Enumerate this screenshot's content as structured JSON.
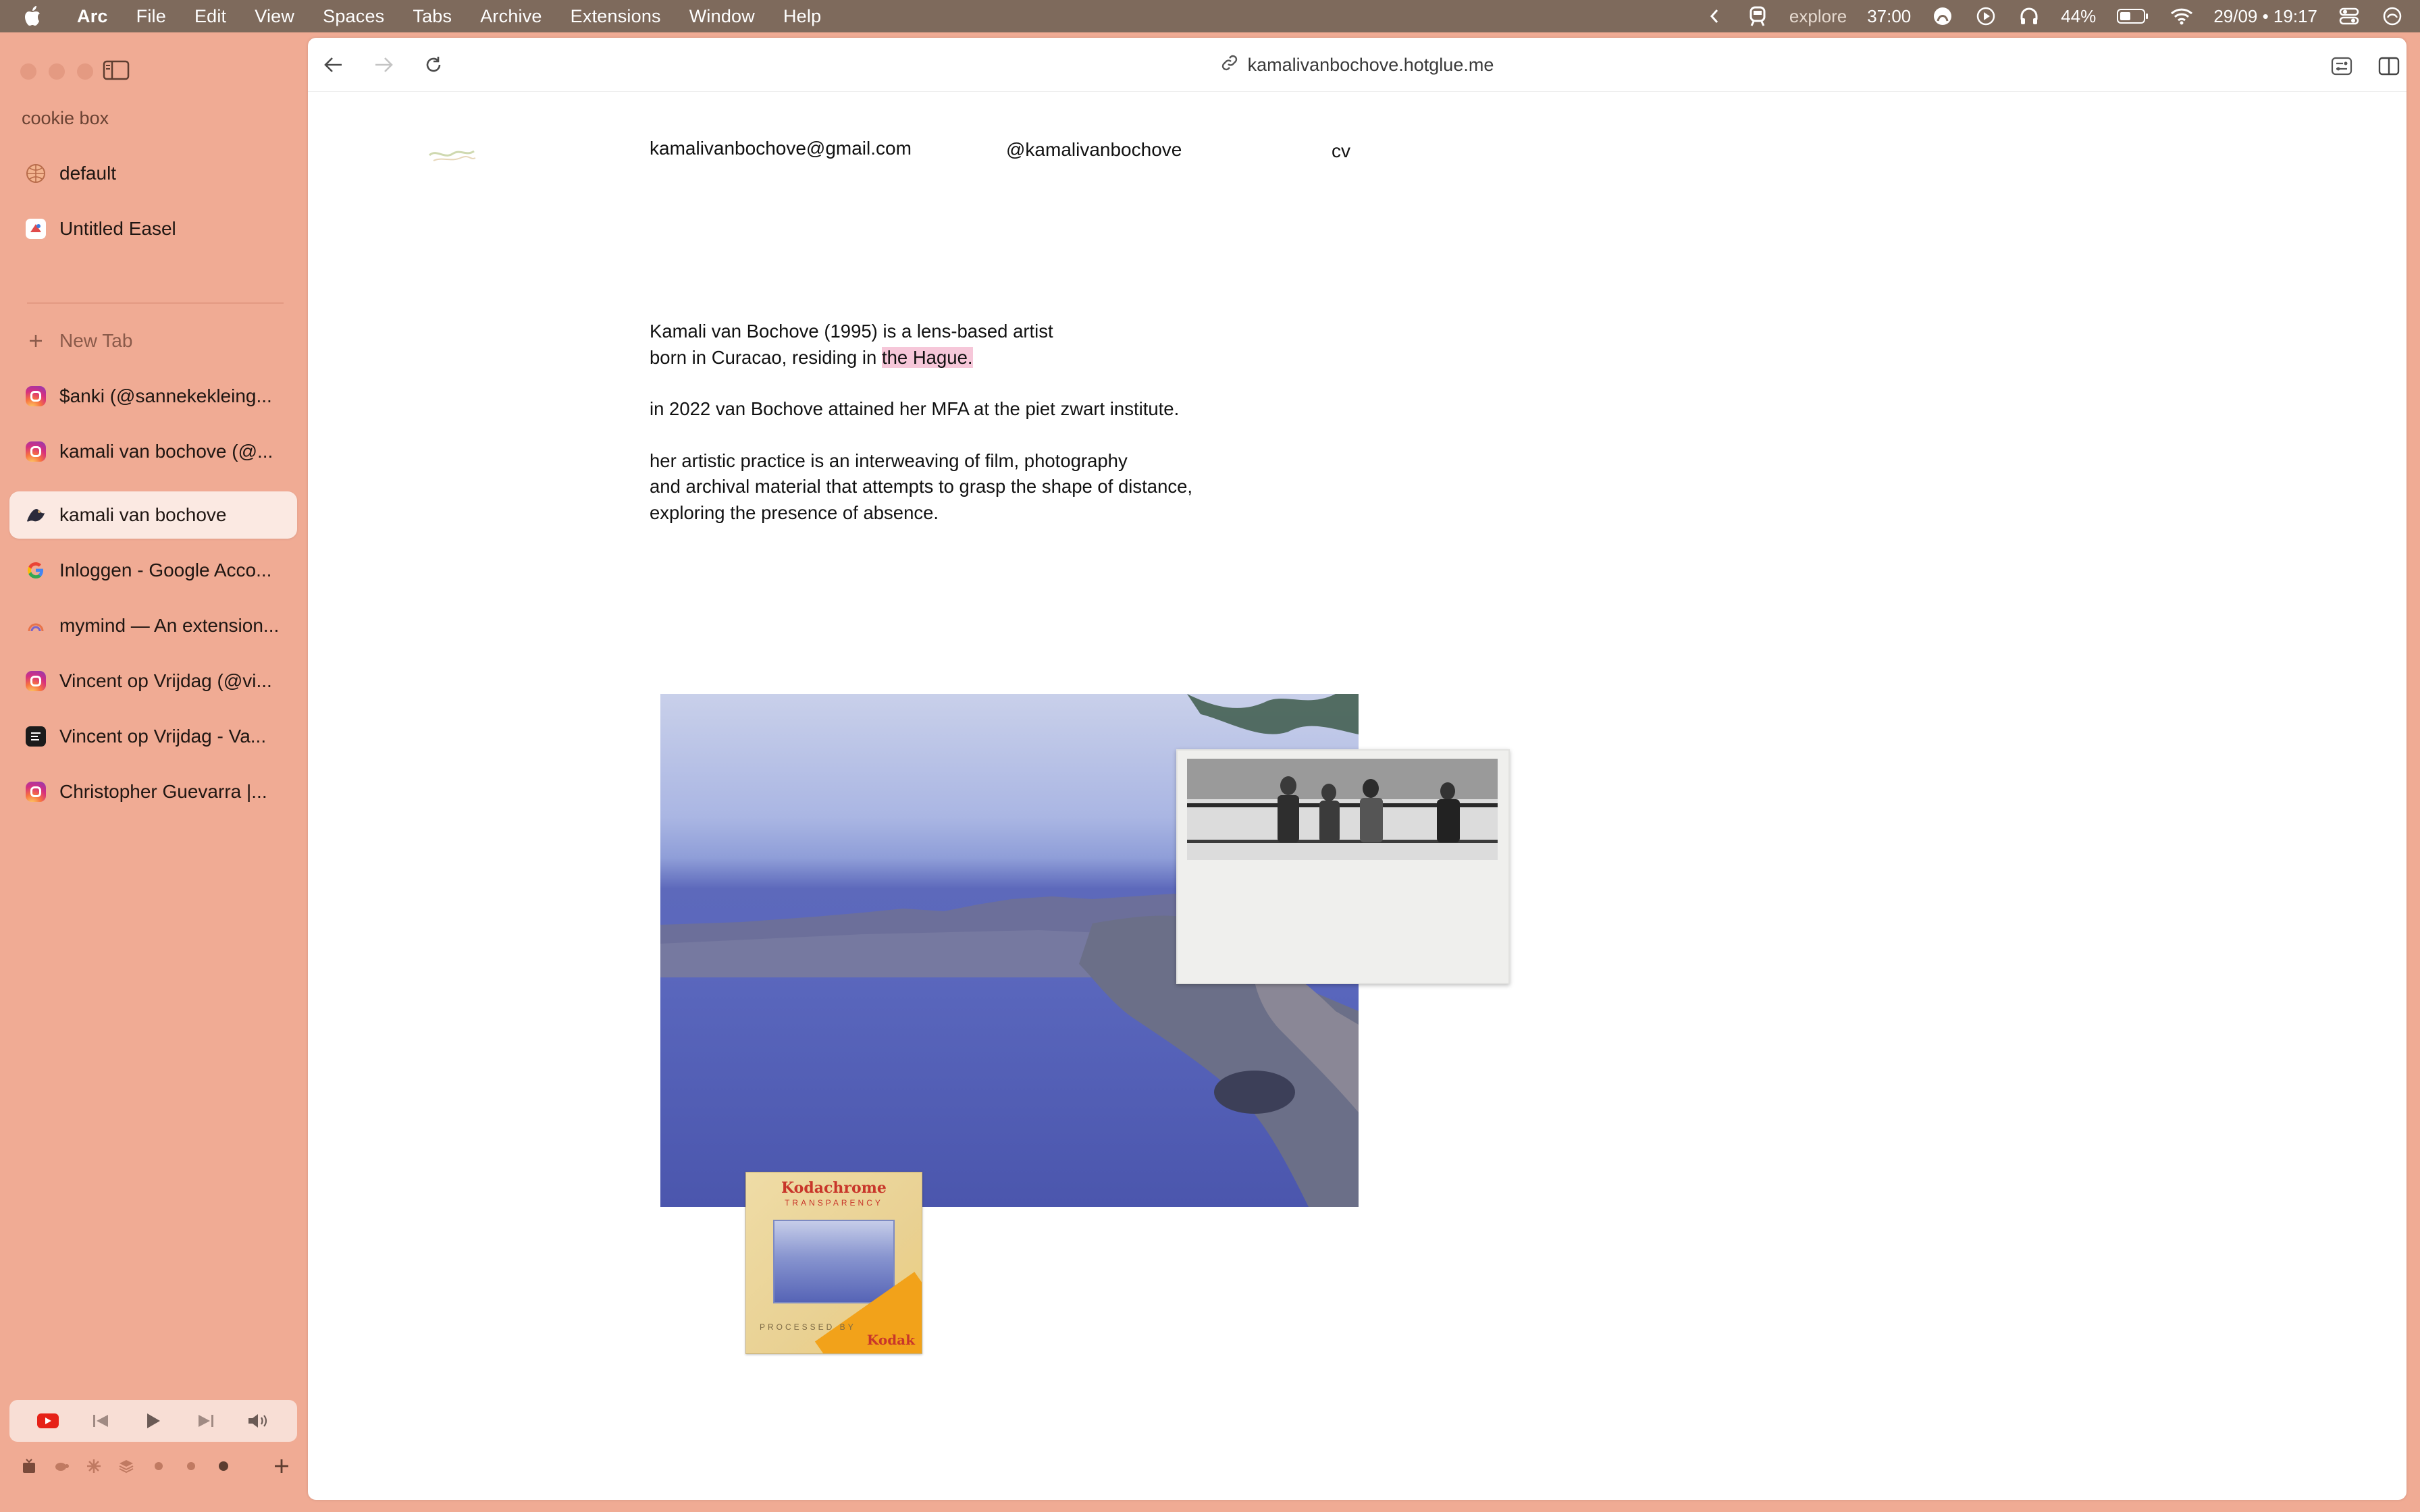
{
  "menubar": {
    "app_name": "Arc",
    "items": [
      "File",
      "Edit",
      "View",
      "Spaces",
      "Tabs",
      "Archive",
      "Extensions",
      "Window",
      "Help"
    ],
    "status": {
      "focus_label": "explore",
      "timer": "37:00",
      "battery": "44%",
      "datetime": "29/09 • 19:17"
    }
  },
  "sidebar": {
    "space_name": "cookie box",
    "pinned": [
      {
        "label": "default",
        "icon": "globe-icon"
      },
      {
        "label": "Untitled Easel",
        "icon": "easel-icon"
      }
    ],
    "new_tab_label": "New Tab",
    "tabs": [
      {
        "label": "$anki (@sannekekleing...",
        "icon": "instagram-icon"
      },
      {
        "label": "kamali van bochove (@...",
        "icon": "instagram-icon"
      },
      {
        "label": "kamali van bochove",
        "icon": "hotglue-icon",
        "active": true
      },
      {
        "label": "Inloggen - Google Acco...",
        "icon": "google-icon"
      },
      {
        "label": "mymind — An extension...",
        "icon": "mymind-icon"
      },
      {
        "label": "Vincent op Vrijdag (@vi...",
        "icon": "instagram-icon"
      },
      {
        "label": "Vincent op Vrijdag - Va...",
        "icon": "site-icon"
      },
      {
        "label": "Christopher Guevarra |...",
        "icon": "instagram-icon"
      }
    ]
  },
  "browser": {
    "url": "kamalivanbochove.hotglue.me"
  },
  "page": {
    "email": "kamalivanbochove@gmail.com",
    "handle": "@kamalivanbochove",
    "cv_link": "cv",
    "bio_p1_pre": "Kamali van Bochove (1995) is a lens-based artist\nborn in Curacao, residing in ",
    "bio_p1_highlight": "the Hague.",
    "bio_p2": "in 2022 van Bochove attained her MFA at the piet zwart institute.",
    "bio_p3": "her artistic practice is an interweaving of film, photography\nand archival material that attempts to grasp the shape of distance,\nexploring the presence of absence.",
    "kodak_brand": "Kodachrome",
    "kodak_sub": "TRANSPARENCY",
    "kodak_processed": "PROCESSED BY",
    "kodak_name": "Kodak"
  }
}
